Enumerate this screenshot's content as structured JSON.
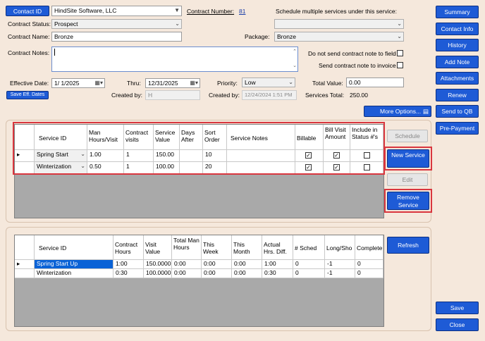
{
  "contact_id_label": "Contact ID",
  "customer_name": "HindSite Software, LLC",
  "contract_number_label": "Contract Number:",
  "contract_number": "81",
  "schedule_multiple_label": "Schedule multiple services under this service:",
  "contract_status_label": "Contract Status:",
  "contract_status": "Prospect",
  "contract_name_label": "Contract Name:",
  "contract_name": "Bronze",
  "package_label": "Package:",
  "package": "Bronze",
  "contract_notes_label": "Contract Notes:",
  "do_not_send_note_label": "Do not send contract note to field",
  "send_note_invoice_label": "Send contract note to invoice",
  "effective_date_label": "Effective Date:",
  "effective_date": "1/  1/2025",
  "thru_label": "Thru:",
  "thru_date": "12/31/2025",
  "priority_label": "Priority:",
  "priority": "Low",
  "total_value_label": "Total Value:",
  "total_value": "0.00",
  "save_eff_dates": "Save Eff. Dates",
  "created_by_label": "Created by:",
  "created_by_value": "H",
  "created_by2_label": "Created by:",
  "created_date": "12/24/2024 1:51 PM",
  "services_total_label": "Services Total:",
  "services_total": "250.00",
  "more_options": "More Options...",
  "sidebar": [
    "Summary",
    "Contact Info",
    "History",
    "Add Note",
    "Attachments",
    "Renew",
    "Send to QB",
    "Pre-Payment"
  ],
  "save": "Save",
  "close": "Close",
  "services_grid": {
    "headers": [
      "Service ID",
      "Man Hours/Visit",
      "Contract visits",
      "Service Value",
      "Days After",
      "Sort Order",
      "Service Notes",
      "Billable",
      "Bill Visit Amount",
      "Include in Status #'s"
    ],
    "rows": [
      {
        "service": "Spring Start",
        "hours": "1.00",
        "visits": "1",
        "value": "150.00",
        "days": "",
        "sort": "10",
        "notes": "",
        "billable": true,
        "bill_visit": true,
        "include": false
      },
      {
        "service": "Winterization",
        "hours": "0.50",
        "visits": "1",
        "value": "100.00",
        "days": "",
        "sort": "20",
        "notes": "",
        "billable": true,
        "bill_visit": true,
        "include": false
      }
    ]
  },
  "schedule": "Schedule",
  "new_service": "New Service",
  "edit": "Edit",
  "remove_service": "Remove Service",
  "summary_grid": {
    "headers": [
      "Service ID",
      "Contract Hours",
      "Visit Value",
      "Total Man Hours",
      "This Week",
      "This Month",
      "Actual Hrs. Diff.",
      "# Sched",
      "Long/Sho",
      "Complete"
    ],
    "rows": [
      [
        "Spring Start Up",
        "1:00",
        "150.0000",
        "0:00",
        "0:00",
        "0:00",
        "1:00",
        "0",
        "-1",
        "0"
      ],
      [
        "Winterization",
        "0:30",
        "100.0000",
        "0:00",
        "0:00",
        "0:00",
        "0:30",
        "0",
        "-1",
        "0"
      ]
    ]
  },
  "refresh": "Refresh"
}
